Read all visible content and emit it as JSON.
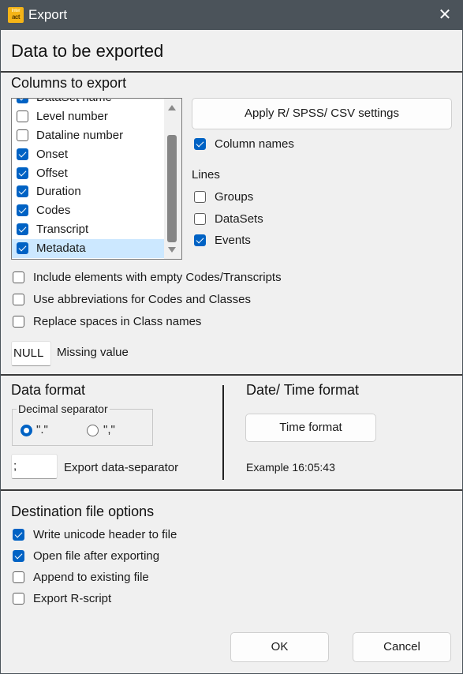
{
  "window": {
    "title": "Export",
    "app_icon": "interact-logo-icon",
    "close_icon": "close-icon"
  },
  "header": {
    "title": "Data to be exported"
  },
  "columns_section": {
    "title": "Columns to export",
    "items": [
      {
        "label": "DataSet name",
        "checked": true,
        "selected": false
      },
      {
        "label": "Level number",
        "checked": false,
        "selected": false
      },
      {
        "label": "Dataline number",
        "checked": false,
        "selected": false
      },
      {
        "label": "Onset",
        "checked": true,
        "selected": false
      },
      {
        "label": "Offset",
        "checked": true,
        "selected": false
      },
      {
        "label": "Duration",
        "checked": true,
        "selected": false
      },
      {
        "label": "Codes",
        "checked": true,
        "selected": false
      },
      {
        "label": "Transcript",
        "checked": true,
        "selected": false
      },
      {
        "label": "Metadata",
        "checked": true,
        "selected": true
      }
    ],
    "apply_button": "Apply R/ SPSS/ CSV settings",
    "column_names": {
      "label": "Column names",
      "checked": true
    },
    "lines_label": "Lines",
    "lines": [
      {
        "label": "Groups",
        "checked": false
      },
      {
        "label": "DataSets",
        "checked": false
      },
      {
        "label": "Events",
        "checked": true
      }
    ],
    "options": [
      {
        "label": "Include elements with empty Codes/Transcripts",
        "checked": false
      },
      {
        "label": "Use abbreviations for Codes and Classes",
        "checked": false
      },
      {
        "label": "Replace spaces in Class names",
        "checked": false
      }
    ],
    "missing_value": {
      "value": "NULL",
      "label": "Missing value"
    }
  },
  "data_format": {
    "title": "Data format",
    "decimal_separator": {
      "legend": "Decimal separator",
      "options": [
        {
          "label": "\".\"",
          "selected": true
        },
        {
          "label": "\",\"",
          "selected": false
        }
      ]
    },
    "export_separator": {
      "value": ";",
      "label": "Export data-separator"
    }
  },
  "datetime_format": {
    "title": "Date/ Time format",
    "button": "Time format",
    "example": "Example 16:05:43"
  },
  "destination": {
    "title": "Destination file options",
    "options": [
      {
        "label": "Write unicode header to file",
        "checked": true
      },
      {
        "label": "Open file after exporting",
        "checked": true
      },
      {
        "label": "Append to existing file",
        "checked": false
      },
      {
        "label": "Export R-script",
        "checked": false
      }
    ]
  },
  "footer": {
    "ok": "OK",
    "cancel": "Cancel"
  },
  "colors": {
    "accent": "#0062c4",
    "titlebar": "#4b535a",
    "selection": "#cce8ff",
    "app_icon": "#f5b417"
  }
}
